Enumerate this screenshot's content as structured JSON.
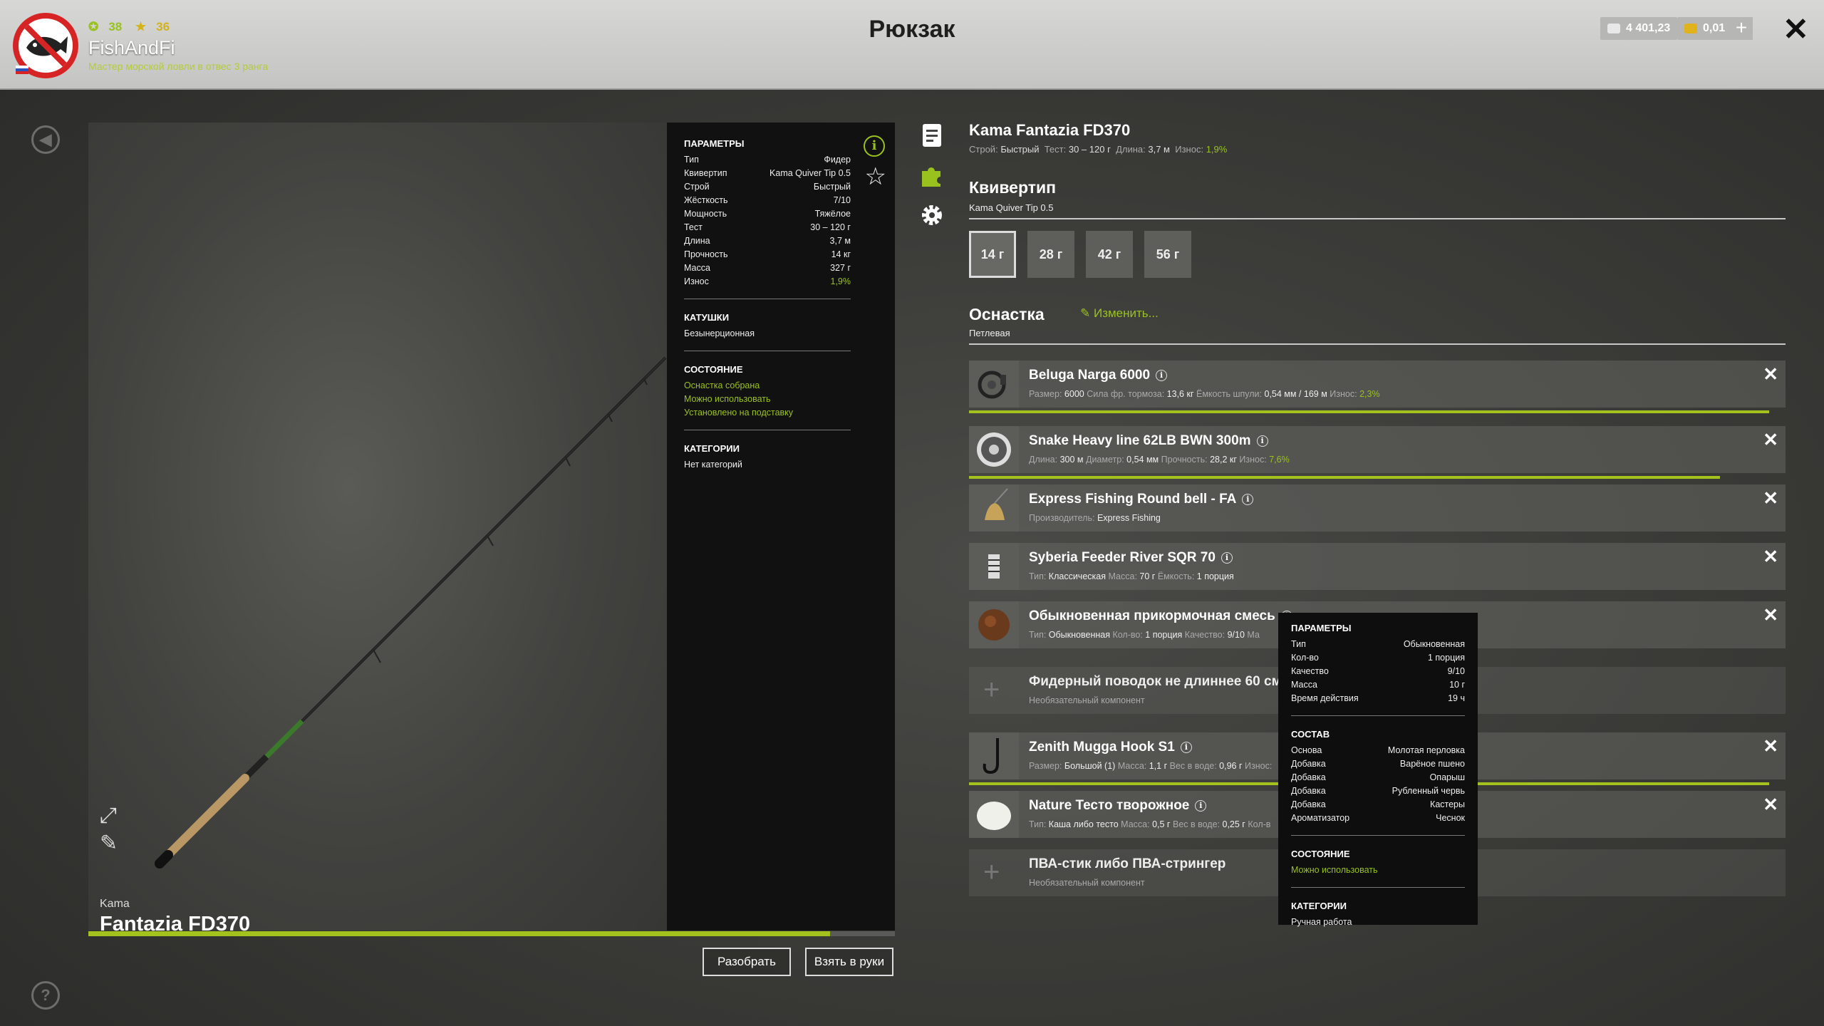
{
  "header": {
    "title": "Рюкзак",
    "player": {
      "name": "FishAndFi",
      "rank_text": "Мастер морской ловли в отвес 3 ранга",
      "level": "38",
      "stars": "36"
    },
    "money": {
      "silver": "4 401,23",
      "gold": "0,01"
    }
  },
  "rod": {
    "brand": "Kama",
    "model": "Fantazia FD370",
    "wear_fraction": 0.92
  },
  "params_panel": {
    "params_title": "ПАРАМЕТРЫ",
    "params": [
      {
        "k": "Тип",
        "v": "Фидер"
      },
      {
        "k": "Квивертип",
        "v": "Kama Quiver Tip 0.5"
      },
      {
        "k": "Строй",
        "v": "Быстрый"
      },
      {
        "k": "Жёсткость",
        "v": "7/10"
      },
      {
        "k": "Мощность",
        "v": "Тяжёлое"
      },
      {
        "k": "Тест",
        "v": "30 – 120 г"
      },
      {
        "k": "Длина",
        "v": "3,7 м"
      },
      {
        "k": "Прочность",
        "v": "14 кг"
      },
      {
        "k": "Масса",
        "v": "327 г"
      },
      {
        "k": "Износ",
        "v": "1,9%"
      }
    ],
    "reels_title": "КАТУШКИ",
    "reels_value": "Безынерционная",
    "state_title": "СОСТОЯНИЕ",
    "states": [
      "Оснастка собрана",
      "Можно использовать",
      "Установлено на подставку"
    ],
    "categories_title": "КАТЕГОРИИ",
    "categories_value": "Нет категорий"
  },
  "buttons": {
    "disassemble": "Разобрать",
    "take": "Взять в руки"
  },
  "detail": {
    "rod_title": "Kama Fantazia FD370",
    "rod_sub": {
      "k1": "Строй:",
      "v1": "Быстрый",
      "k2": "Тест:",
      "v2": "30 – 120 г",
      "k3": "Длина:",
      "v3": "3,7 м",
      "k4": "Износ:",
      "v4": "1,9%"
    },
    "quiver_title": "Квивертип",
    "quiver_sub": "Kama Quiver Tip 0.5",
    "quiver_options": [
      "14 г",
      "28 г",
      "42 г",
      "56 г"
    ],
    "rig_title": "Оснастка",
    "rig_edit": "Изменить...",
    "rig_sub": "Петлевая",
    "components": [
      {
        "name": "Beluga Narga 6000",
        "sub": [
          [
            "Размер:",
            "6000"
          ],
          [
            "Сила фр. тормоза:",
            "13,6 кг"
          ],
          [
            "Ёмкость шпули:",
            "0,54 мм / 169 м"
          ],
          [
            "Износ:",
            "2,3%"
          ]
        ],
        "bar": 0.98
      },
      {
        "name": "Snake Heavy line 62LB BWN 300m",
        "sub": [
          [
            "Длина:",
            "300 м"
          ],
          [
            "Диаметр:",
            "0,54 мм"
          ],
          [
            "Прочность:",
            "28,2 кг"
          ],
          [
            "Износ:",
            "7,6%"
          ]
        ],
        "bar": 0.92
      },
      {
        "name": "Express Fishing Round bell - FA",
        "sub": [
          [
            "Производитель:",
            "Express Fishing"
          ]
        ]
      },
      {
        "name": "Syberia Feeder River SQR 70",
        "sub": [
          [
            "Тип:",
            "Классическая"
          ],
          [
            "Масса:",
            "70 г"
          ],
          [
            "Ёмкость:",
            "1 порция"
          ]
        ]
      },
      {
        "name": "Обыкновенная прикормочная смесь",
        "sub": [
          [
            "Тип:",
            "Обыкновенная"
          ],
          [
            "Кол-во:",
            "1 порция"
          ],
          [
            "Качество:",
            "9/10"
          ],
          [
            "Ма",
            ""
          ]
        ]
      },
      {
        "name": "Фидерный поводок не длиннее 60 см",
        "sub_text": "Необязательный компонент"
      },
      {
        "name": "Zenith Mugga Hook S1",
        "sub": [
          [
            "Размер:",
            "Большой (1)"
          ],
          [
            "Масса:",
            "1,1 г"
          ],
          [
            "Вес в воде:",
            "0,96 г"
          ],
          [
            "Износ:",
            ""
          ]
        ],
        "bar": 0.98
      },
      {
        "name": "Nature Тесто творожное",
        "sub": [
          [
            "Тип:",
            "Каша либо тесто"
          ],
          [
            "Масса:",
            "0,5 г"
          ],
          [
            "Вес в воде:",
            "0,25 г"
          ],
          [
            "Кол-в",
            ""
          ]
        ]
      },
      {
        "name": "ПВА-стик либо ПВА-стрингер",
        "sub_text": "Необязательный компонент"
      }
    ]
  },
  "tooltip": {
    "params_title": "ПАРАМЕТРЫ",
    "params": [
      {
        "k": "Тип",
        "v": "Обыкновенная"
      },
      {
        "k": "Кол-во",
        "v": "1 порция"
      },
      {
        "k": "Качество",
        "v": "9/10"
      },
      {
        "k": "Масса",
        "v": "10 г"
      },
      {
        "k": "Время действия",
        "v": "19 ч"
      }
    ],
    "comp_title": "СОСТАВ",
    "composition": [
      {
        "k": "Основа",
        "v": "Молотая перловка"
      },
      {
        "k": "Добавка",
        "v": "Варёное пшено"
      },
      {
        "k": "Добавка",
        "v": "Опарыш"
      },
      {
        "k": "Добавка",
        "v": "Рубленный червь"
      },
      {
        "k": "Добавка",
        "v": "Кастеры"
      },
      {
        "k": "Ароматизатор",
        "v": "Чеснок"
      }
    ],
    "state_title": "СОСТОЯНИЕ",
    "state_value": "Можно использовать",
    "categories_title": "КАТЕГОРИИ",
    "categories_value": "Ручная работа"
  },
  "colors": {
    "accent": "#9ac21f",
    "alert": "#d62424"
  },
  "icons": [
    "back-icon",
    "help-icon",
    "fullscreen-icon",
    "brush-icon",
    "info-icon",
    "favorite-star-icon",
    "description-icon",
    "puzzle-icon",
    "gear-icon",
    "edit-icon",
    "close-icon"
  ]
}
